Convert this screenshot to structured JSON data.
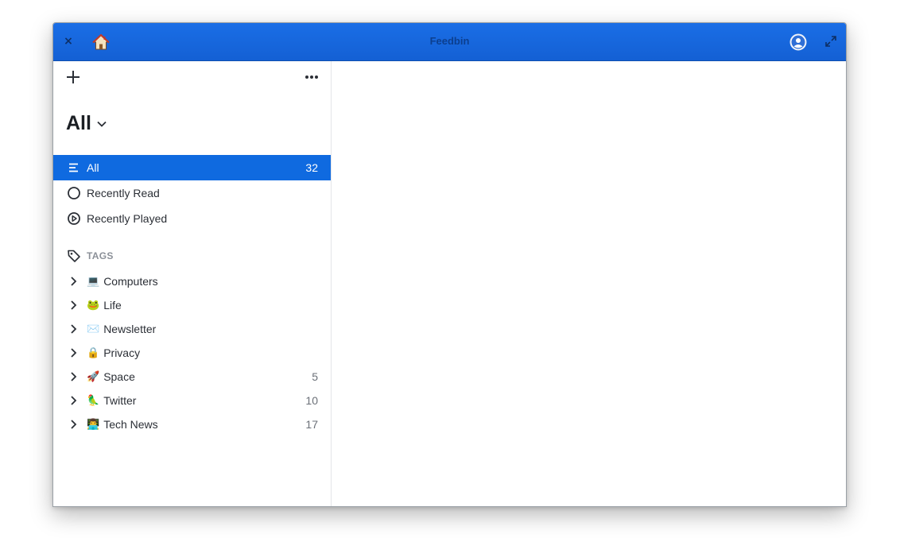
{
  "window": {
    "title": "Feedbin",
    "close_glyph": "×",
    "colors": {
      "titlebar": "#1565dc",
      "selection": "#0f6ae0"
    }
  },
  "toolbar": {
    "add_icon": "plus-icon",
    "more_icon": "ellipsis-icon"
  },
  "view": {
    "title": "All"
  },
  "nav": [
    {
      "label": "All",
      "count": "32",
      "icon": "list-icon",
      "selected": true
    },
    {
      "label": "Recently Read",
      "count": "",
      "icon": "circle-icon",
      "selected": false
    },
    {
      "label": "Recently Played",
      "count": "",
      "icon": "play-circle-icon",
      "selected": false
    }
  ],
  "tags": {
    "header": "TAGS",
    "items": [
      {
        "emoji": "💻",
        "label": "Computers",
        "count": ""
      },
      {
        "emoji": "🐸",
        "label": "Life",
        "count": ""
      },
      {
        "emoji": "✉️",
        "label": "Newsletter",
        "count": ""
      },
      {
        "emoji": "🔒",
        "label": "Privacy",
        "count": ""
      },
      {
        "emoji": "🚀",
        "label": "Space",
        "count": "5"
      },
      {
        "emoji": "🦜",
        "label": "Twitter",
        "count": "10"
      },
      {
        "emoji": "👨‍💻",
        "label": "Tech News",
        "count": "17"
      }
    ]
  }
}
